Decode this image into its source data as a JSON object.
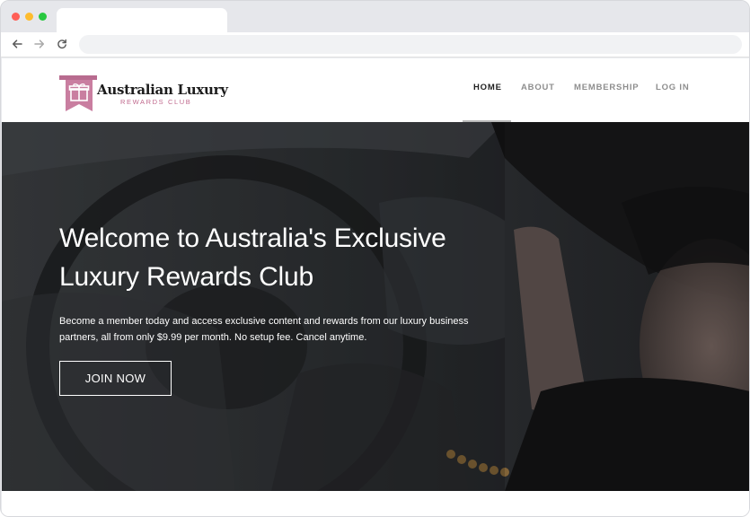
{
  "browser": {
    "controls": [
      "close",
      "minimize",
      "maximize"
    ],
    "nav_icons": [
      "back-arrow-icon",
      "forward-arrow-icon",
      "reload-icon"
    ]
  },
  "site": {
    "logo": {
      "title": "Australian Luxury",
      "subtitle": "REWARDS CLUB",
      "icon": "gift-ribbon-icon",
      "accent_color": "#c97ea0"
    },
    "nav": {
      "items": [
        {
          "label": "HOME",
          "active": true
        },
        {
          "label": "ABOUT",
          "active": false
        },
        {
          "label": "MEMBERSHIP",
          "active": false
        },
        {
          "label": "LOG IN",
          "active": false
        }
      ]
    },
    "hero": {
      "title_line1": "Welcome to Australia's Exclusive",
      "title_line2": "Luxury Rewards Club",
      "text_line1": "Become a member today and access exclusive content and rewards from our luxury business",
      "text_line2": "partners, all from only $9.99 per month. No setup fee. Cancel anytime.",
      "cta_label": "JOIN NOW"
    }
  }
}
